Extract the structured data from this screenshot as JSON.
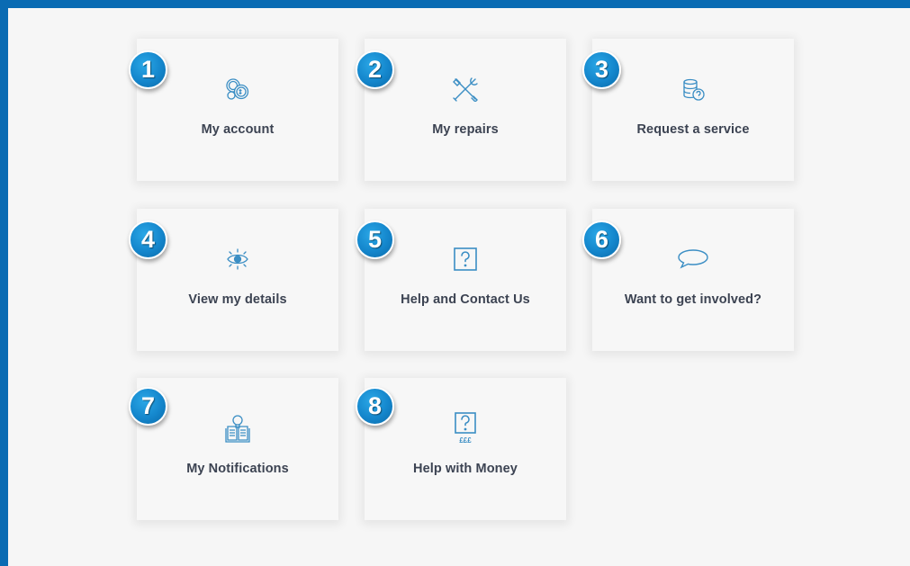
{
  "colors": {
    "frame": "#0a6bb3",
    "panel": "#f6f6f6",
    "tile": "#f7f7f7",
    "icon": "#3b8ec4",
    "label": "#3c4352",
    "badge": "#1486cc"
  },
  "tiles": [
    {
      "number": "1",
      "label": "My account",
      "icon": "coins-icon"
    },
    {
      "number": "2",
      "label": "My repairs",
      "icon": "tools-icon"
    },
    {
      "number": "3",
      "label": "Request a service",
      "icon": "coin-stack-question-icon"
    },
    {
      "number": "4",
      "label": "View my details",
      "icon": "eye-icon"
    },
    {
      "number": "5",
      "label": "Help and Contact Us",
      "icon": "question-box-icon"
    },
    {
      "number": "6",
      "label": "Want to get involved?",
      "icon": "speech-bubble-icon"
    },
    {
      "number": "7",
      "label": "My Notifications",
      "icon": "notebook-lightbulb-icon"
    },
    {
      "number": "8",
      "label": "Help with Money",
      "icon": "question-money-icon"
    }
  ]
}
